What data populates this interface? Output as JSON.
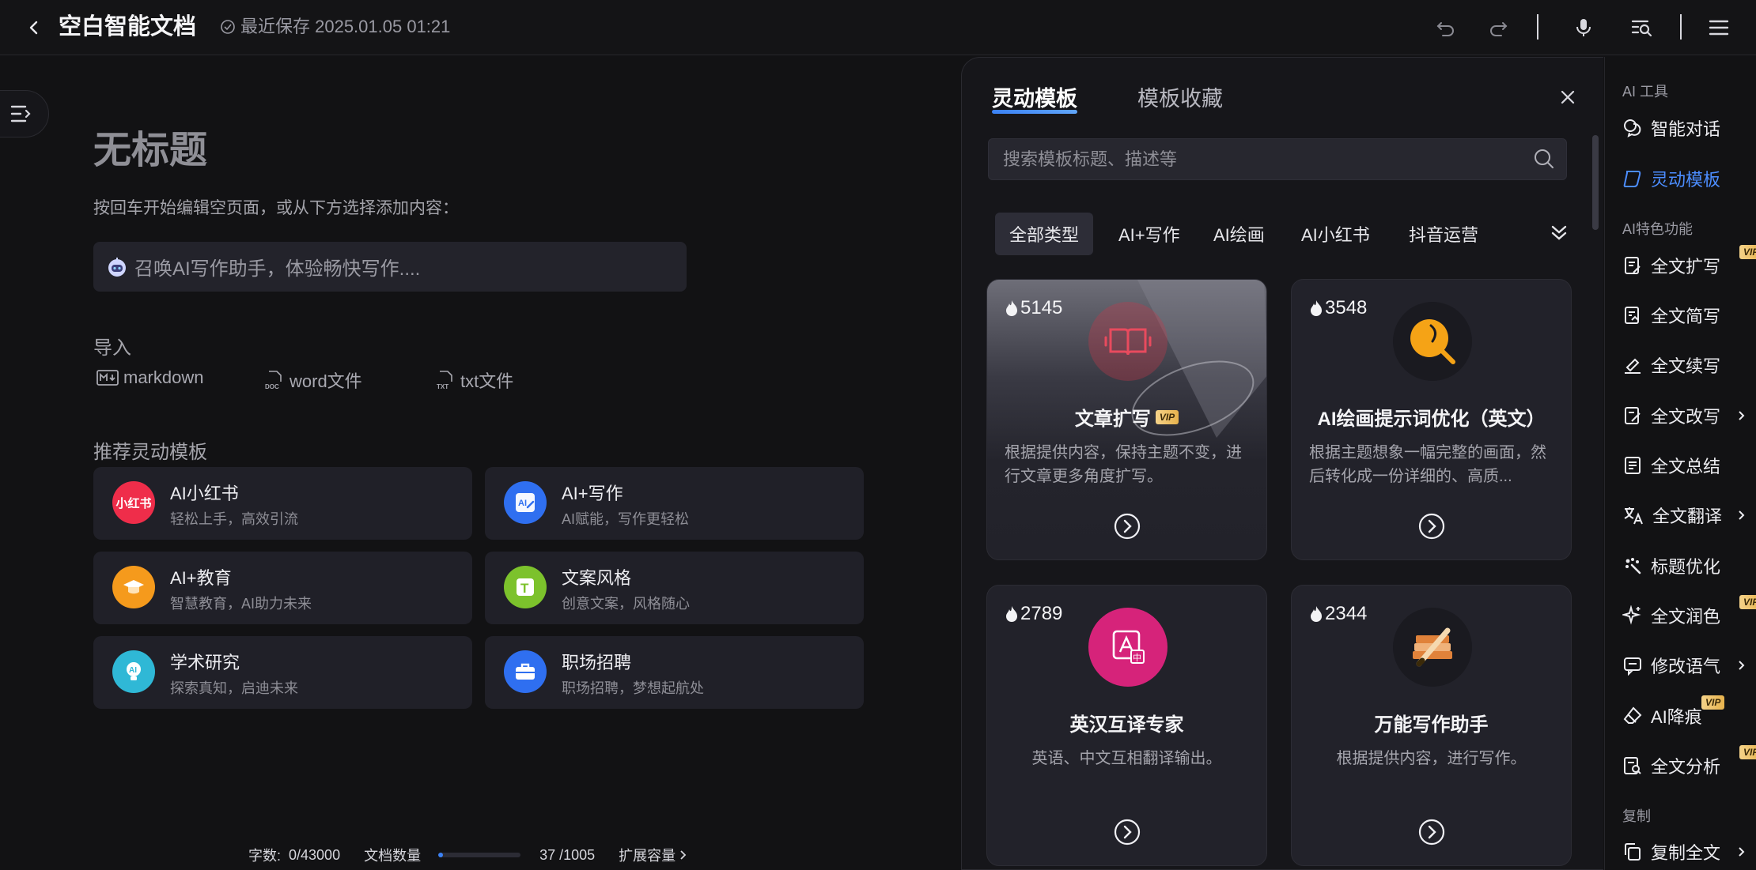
{
  "topbar": {
    "title": "空白智能文档",
    "save_status": "最近保存 2025.01.05 01:21"
  },
  "editor": {
    "page_title": "无标题",
    "hint": "按回车开始编辑空页面，或从下方选择添加内容：",
    "ai_prompt": "召唤AI写作助手，体验畅快写作....",
    "import_label": "导入",
    "imports": [
      "markdown",
      "word文件",
      "txt文件"
    ],
    "recommend_label": "推荐灵动模板",
    "recommend": [
      {
        "title": "AI小红书",
        "sub": "轻松上手，高效引流",
        "icon_text": "小红书",
        "color": "#ef2d4a"
      },
      {
        "title": "AI+写作",
        "sub": "AI赋能，写作更轻松",
        "icon_text": "AI",
        "color": "#2f6ff0"
      },
      {
        "title": "AI+教育",
        "sub": "智慧教育，AI助力未来",
        "icon_text": "",
        "color": "#f59a1c"
      },
      {
        "title": "文案风格",
        "sub": "创意文案，风格随心",
        "icon_text": "T",
        "color": "#7cc22c"
      },
      {
        "title": "学术研究",
        "sub": "探索真知，启迪未来",
        "icon_text": "AI",
        "color": "#2fb8d6"
      },
      {
        "title": "职场招聘",
        "sub": "职场招聘，梦想起航处",
        "icon_text": "",
        "color": "#2f6ff0"
      }
    ]
  },
  "status": {
    "word_count_label": "字数:",
    "word_count": "0/43000",
    "doc_count_label": "文档数量",
    "doc_count": "37 /1005",
    "doc_progress": 0.037,
    "expand": "扩展容量"
  },
  "panel": {
    "tab_active": "灵动模板",
    "tab_inactive": "模板收藏",
    "search_placeholder": "搜索模板标题、描述等",
    "chips": [
      "全部类型",
      "AI+写作",
      "AI绘画",
      "AI小红书",
      "抖音运营"
    ],
    "cards": [
      {
        "count": "5145",
        "title": "文章扩写",
        "vip": "VIP",
        "desc": "根据提供内容，保持主题不变，进行文章更多角度扩写。",
        "icon": "book-icon",
        "icon_color": "#c23a4a"
      },
      {
        "count": "3548",
        "title": "AI绘画提示词优化（英文）",
        "vip": "",
        "desc": "根据主题想象一幅完整的画面，然后转化成一份详细的、高质...",
        "icon": "brush-search-icon",
        "icon_color": "#f5a316"
      },
      {
        "count": "2789",
        "title": "英汉互译专家",
        "vip": "",
        "desc": "英语、中文互相翻译输出。",
        "icon": "translate-icon",
        "icon_color": "#d6237a"
      },
      {
        "count": "2344",
        "title": "万能写作助手",
        "vip": "",
        "desc": "根据提供内容，进行写作。",
        "icon": "pencil-books-icon",
        "icon_color": "#e0823a"
      }
    ]
  },
  "tools": {
    "group1": "AI 工具",
    "group2": "AI特色功能",
    "group3": "复制",
    "vip": "VIP",
    "items": [
      {
        "label": "智能对话"
      },
      {
        "label": "灵动模板"
      },
      {
        "label": "全文扩写"
      },
      {
        "label": "全文简写"
      },
      {
        "label": "全文续写"
      },
      {
        "label": "全文改写"
      },
      {
        "label": "全文总结"
      },
      {
        "label": "全文翻译"
      },
      {
        "label": "标题优化"
      },
      {
        "label": "全文润色"
      },
      {
        "label": "修改语气"
      },
      {
        "label": "AI降痕"
      },
      {
        "label": "全文分析"
      },
      {
        "label": "复制全文"
      }
    ]
  }
}
